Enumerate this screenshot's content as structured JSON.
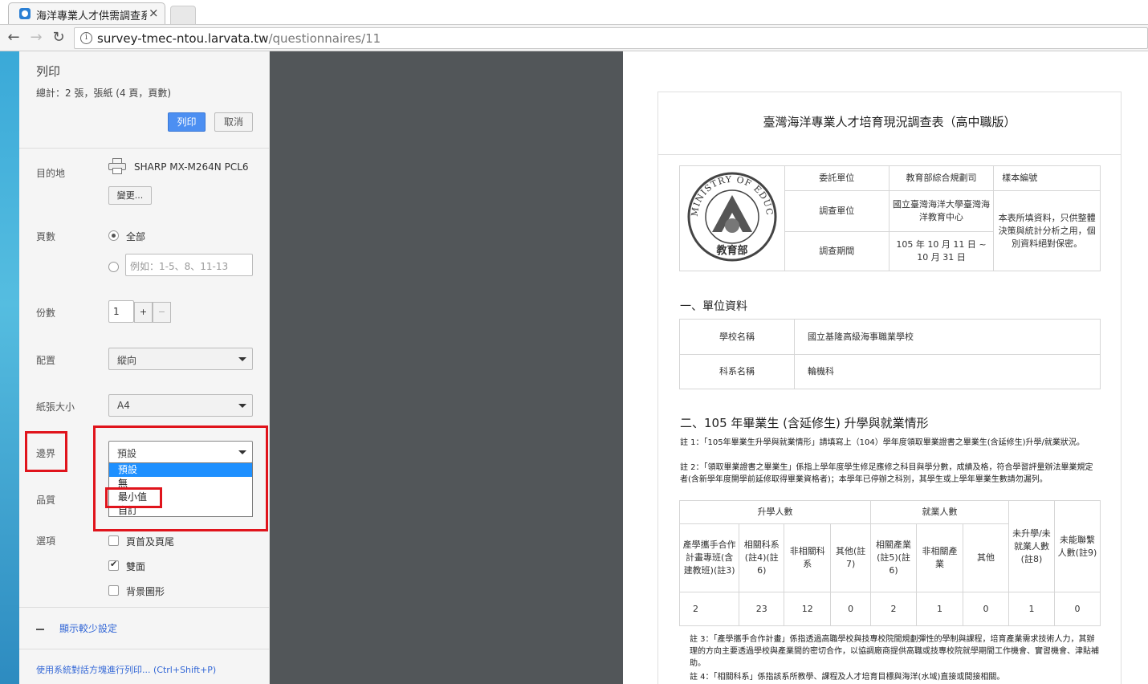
{
  "browser": {
    "tab_title": "海洋專業人才供需調查系",
    "url_host": "survey-tmec-ntou.larvata.tw",
    "url_path": "/questionnaires/11"
  },
  "print_panel": {
    "title": "列印",
    "summary": "總計：2 張，張紙 (4 頁，頁數)",
    "print_label": "列印",
    "cancel_label": "取消",
    "destination_label": "目的地",
    "printer_name": "SHARP MX-M264N PCL6",
    "change_label": "變更...",
    "pages_label": "頁數",
    "pages_all": "全部",
    "pages_placeholder": "例如：1-5、8、11-13",
    "copies_label": "份數",
    "copies_value": "1",
    "copies_plus": "+",
    "copies_minus": "−",
    "layout_label": "配置",
    "layout_value": "縱向",
    "paper_label": "紙張大小",
    "paper_value": "A4",
    "margins_label": "邊界",
    "margins_value": "預設",
    "margins_options": [
      "預設",
      "無",
      "最小值",
      "自訂"
    ],
    "quality_label": "品質",
    "options_label": "選項",
    "opt_header_footer": "頁首及頁尾",
    "opt_duplex": "雙面",
    "opt_background": "背景圖形",
    "fewer_settings": "顯示較少設定",
    "system_dialog": "使用系統對話方塊進行列印... (Ctrl+Shift+P)"
  },
  "document": {
    "title": "臺灣海洋專業人才培育現況調查表（高中職版）",
    "logo_text_arc": "MINISTRY OF EDUCATION",
    "logo_text_cn": "教育部",
    "info": {
      "commission_label": "委託單位",
      "commission_value": "教育部綜合規劃司",
      "sample_label": "樣本編號",
      "survey_unit_label": "調查單位",
      "survey_unit_value": "國立臺灣海洋大學臺灣海洋教育中心",
      "survey_period_label": "調查期間",
      "survey_period_value": "105 年 10 月 11 日 ~ 10 月 31 日",
      "privacy_note": "本表所填資料，只供整體決策與統計分析之用，個別資料絕對保密。"
    },
    "section1": "一、單位資料",
    "school_label": "學校名稱",
    "school_value": "國立基隆高級海事職業學校",
    "dept_label": "科系名稱",
    "dept_value": "輪機科",
    "section2": "二、105 年畢業生 (含延修生) 升學與就業情形",
    "note1": "註 1：「105年畢業生升學與就業情形」請填寫上（104）學年度領取畢業證書之畢業生(含延修生)升學/就業狀況。",
    "note2": "註 2：「領取畢業證書之畢業生」係指上學年度學生修足應修之科目與學分數，成績及格，符合學習評量辦法畢業規定者(含新學年度開學前延修取得畢業資格者)；本學年已停辦之科別，其學生或上學年畢業生數請勿漏列。",
    "stats": {
      "group_further": "升學人數",
      "group_employ": "就業人數",
      "col_coop": "產學攜手合作計畫專班(含建教班)(註3)",
      "col_related": "相關科系(註4)(註6)",
      "col_unrelated": "非相關科系",
      "col_other_edu": "其他(註7)",
      "col_related_ind": "相關產業(註5)(註6)",
      "col_unrelated_ind": "非相關產業",
      "col_other_emp": "其他",
      "col_not_further": "未升學/未就業人數(註8)",
      "col_unreachable": "未能聯繫人數(註9)",
      "values": [
        "2",
        "23",
        "12",
        "0",
        "2",
        "1",
        "0",
        "1",
        "0"
      ]
    },
    "note3": "註 3：「產學攜手合作計畫」係指透過高職學校與技專校院間規劃彈性的學制與課程，培育產業需求技術人力，其辦理的方向主要透過學校與產業間的密切合作，以協調廠商提供高職或技專校院就學期間工作機會、實習機會、津貼補助。",
    "note4": "註 4：「相關科系」係指該系所教學、課程及人才培育目標與海洋(水域)直接或間接相關。"
  },
  "colors": {
    "print_button": "#4c8ff2",
    "highlight_box": "#e0141c",
    "dropdown_selected": "#1e90ff",
    "preview_background": "#525659"
  }
}
